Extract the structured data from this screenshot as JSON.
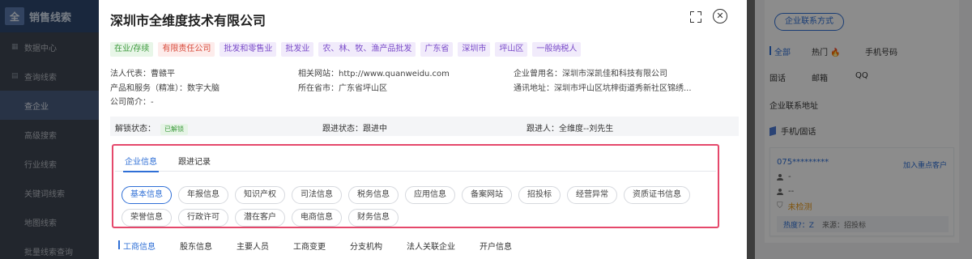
{
  "sidebar": {
    "brand": "销售线索",
    "items": [
      {
        "label": "数据中心"
      },
      {
        "label": "查询线索"
      },
      {
        "label": "查企业"
      },
      {
        "label": "高级搜索"
      },
      {
        "label": "行业线索"
      },
      {
        "label": "关键词线索"
      },
      {
        "label": "地图线索"
      },
      {
        "label": "批量线索查询"
      }
    ]
  },
  "modal": {
    "title": "深圳市全维度技术有限公司",
    "tags": [
      {
        "label": "在业/存续",
        "color": "green"
      },
      {
        "label": "有限责任公司",
        "color": "red"
      },
      {
        "label": "批发和零售业",
        "color": "purple"
      },
      {
        "label": "批发业",
        "color": "purple"
      },
      {
        "label": "农、林、牧、渔产品批发",
        "color": "purple"
      },
      {
        "label": "广东省",
        "color": "purple"
      },
      {
        "label": "深圳市",
        "color": "purple"
      },
      {
        "label": "坪山区",
        "color": "purple"
      },
      {
        "label": "一般纳税人",
        "color": "purple"
      }
    ],
    "info": {
      "legal_rep": "法人代表：曹赣平",
      "website": "相关网站：http://www.quanweidu.com",
      "former_name": "企业曾用名：深圳市深凯佳和科技有限公司",
      "products": "产品和服务（精准）：数字大脑",
      "province": "所在省市：广东省坪山区",
      "address": "通讯地址：深圳市坪山区坑梓街道秀新社区锦绣...",
      "intro": "公司简介：-"
    },
    "status_bar": {
      "unlock_label": "解锁状态：",
      "unlock_badge": "已解锁",
      "follow_status": "跟进状态：跟进中",
      "follower": "跟进人：全维度--刘先生"
    },
    "inner_tabs": [
      {
        "label": "企业信息",
        "active": true
      },
      {
        "label": "跟进记录",
        "active": false
      }
    ],
    "pills": [
      {
        "label": "基本信息",
        "active": true
      },
      {
        "label": "年报信息"
      },
      {
        "label": "知识产权"
      },
      {
        "label": "司法信息"
      },
      {
        "label": "税务信息"
      },
      {
        "label": "应用信息"
      },
      {
        "label": "备案网站"
      },
      {
        "label": "招投标"
      },
      {
        "label": "经营异常"
      },
      {
        "label": "资质证书信息"
      },
      {
        "label": "荣誉信息"
      },
      {
        "label": "行政许可"
      },
      {
        "label": "潜在客户"
      },
      {
        "label": "电商信息"
      },
      {
        "label": "财务信息"
      }
    ],
    "sub_tabs": [
      {
        "label": "工商信息",
        "active": true
      },
      {
        "label": "股东信息"
      },
      {
        "label": "主要人员"
      },
      {
        "label": "工商变更"
      },
      {
        "label": "分支机构"
      },
      {
        "label": "法人关联企业"
      },
      {
        "label": "开户信息"
      }
    ]
  },
  "right_panel": {
    "contact_button": "企业联系方式",
    "tabs": [
      "全部",
      "热门",
      "手机号码",
      "固话",
      "邮箱",
      "QQ",
      "企业联系地址"
    ],
    "section_title": "手机/固话",
    "card": {
      "number": "075*********",
      "add_label": "加入重点客户",
      "line1": "-",
      "line2": "--",
      "status": "未检测",
      "hotness": "热度?：Z",
      "source": "来源：招投标"
    }
  },
  "colors": {
    "accent": "#2f6fd6",
    "highlight_box": "#e5486b",
    "warning": "#e99a1b"
  }
}
